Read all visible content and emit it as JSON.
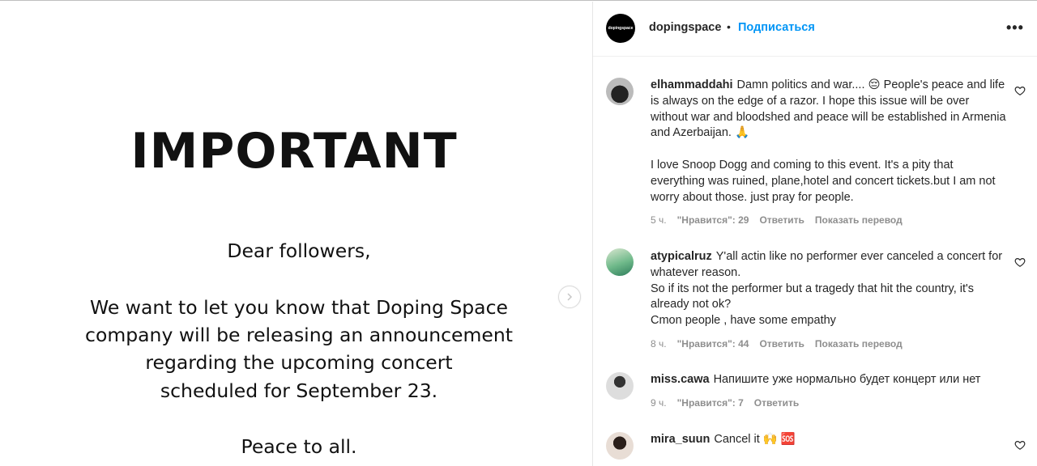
{
  "post": {
    "heading": "IMPORTANT",
    "lines": [
      "Dear followers,",
      "We want to let you know that Doping Space",
      "company will be releasing an announcement",
      "regarding the upcoming concert",
      "scheduled for September 23.",
      "Peace to all."
    ]
  },
  "header": {
    "avatar_text": "dopingspace",
    "username": "dopingspace",
    "separator": "•",
    "follow_label": "Подписаться",
    "more_label": "•••"
  },
  "comments": [
    {
      "username": "elhammaddahi",
      "text_lines": [
        "Damn politics and war.... 😔 People's peace and life is always on the edge of a razor. I hope this issue will be over without war and bloodshed and peace will be established in Armenia and Azerbaijan. 🙏",
        "I love Snoop Dogg and coming to this event. It's a pity that everything was ruined, plane,hotel and concert tickets.but I am not worry about those. just pray for people."
      ],
      "time": "5 ч.",
      "likes": "\"Нравится\": 29",
      "reply": "Ответить",
      "translate": "Показать перевод"
    },
    {
      "username": "atypicalruz",
      "text_lines": [
        "Y'all actin like no performer ever canceled a concert for whatever reason.",
        "So if its not the performer but a tragedy that hit the country, it's already not ok?",
        "Cmon people , have some empathy"
      ],
      "time": "8 ч.",
      "likes": "\"Нравится\": 44",
      "reply": "Ответить",
      "translate": "Показать перевод"
    },
    {
      "username": "miss.cawa",
      "text_lines": [
        "Напишите уже нормально будет концерт или нет"
      ],
      "time": "9 ч.",
      "likes": "\"Нравится\": 7",
      "reply": "Ответить"
    },
    {
      "username": "mira_suun",
      "text_lines": [
        "Cancel it 🙌 🆘"
      ]
    }
  ],
  "icons": {
    "next": "chevron-right-icon",
    "like": "heart-icon"
  },
  "colors": {
    "follow": "#0095f6",
    "muted": "#8e8e8e",
    "text": "#262626"
  }
}
